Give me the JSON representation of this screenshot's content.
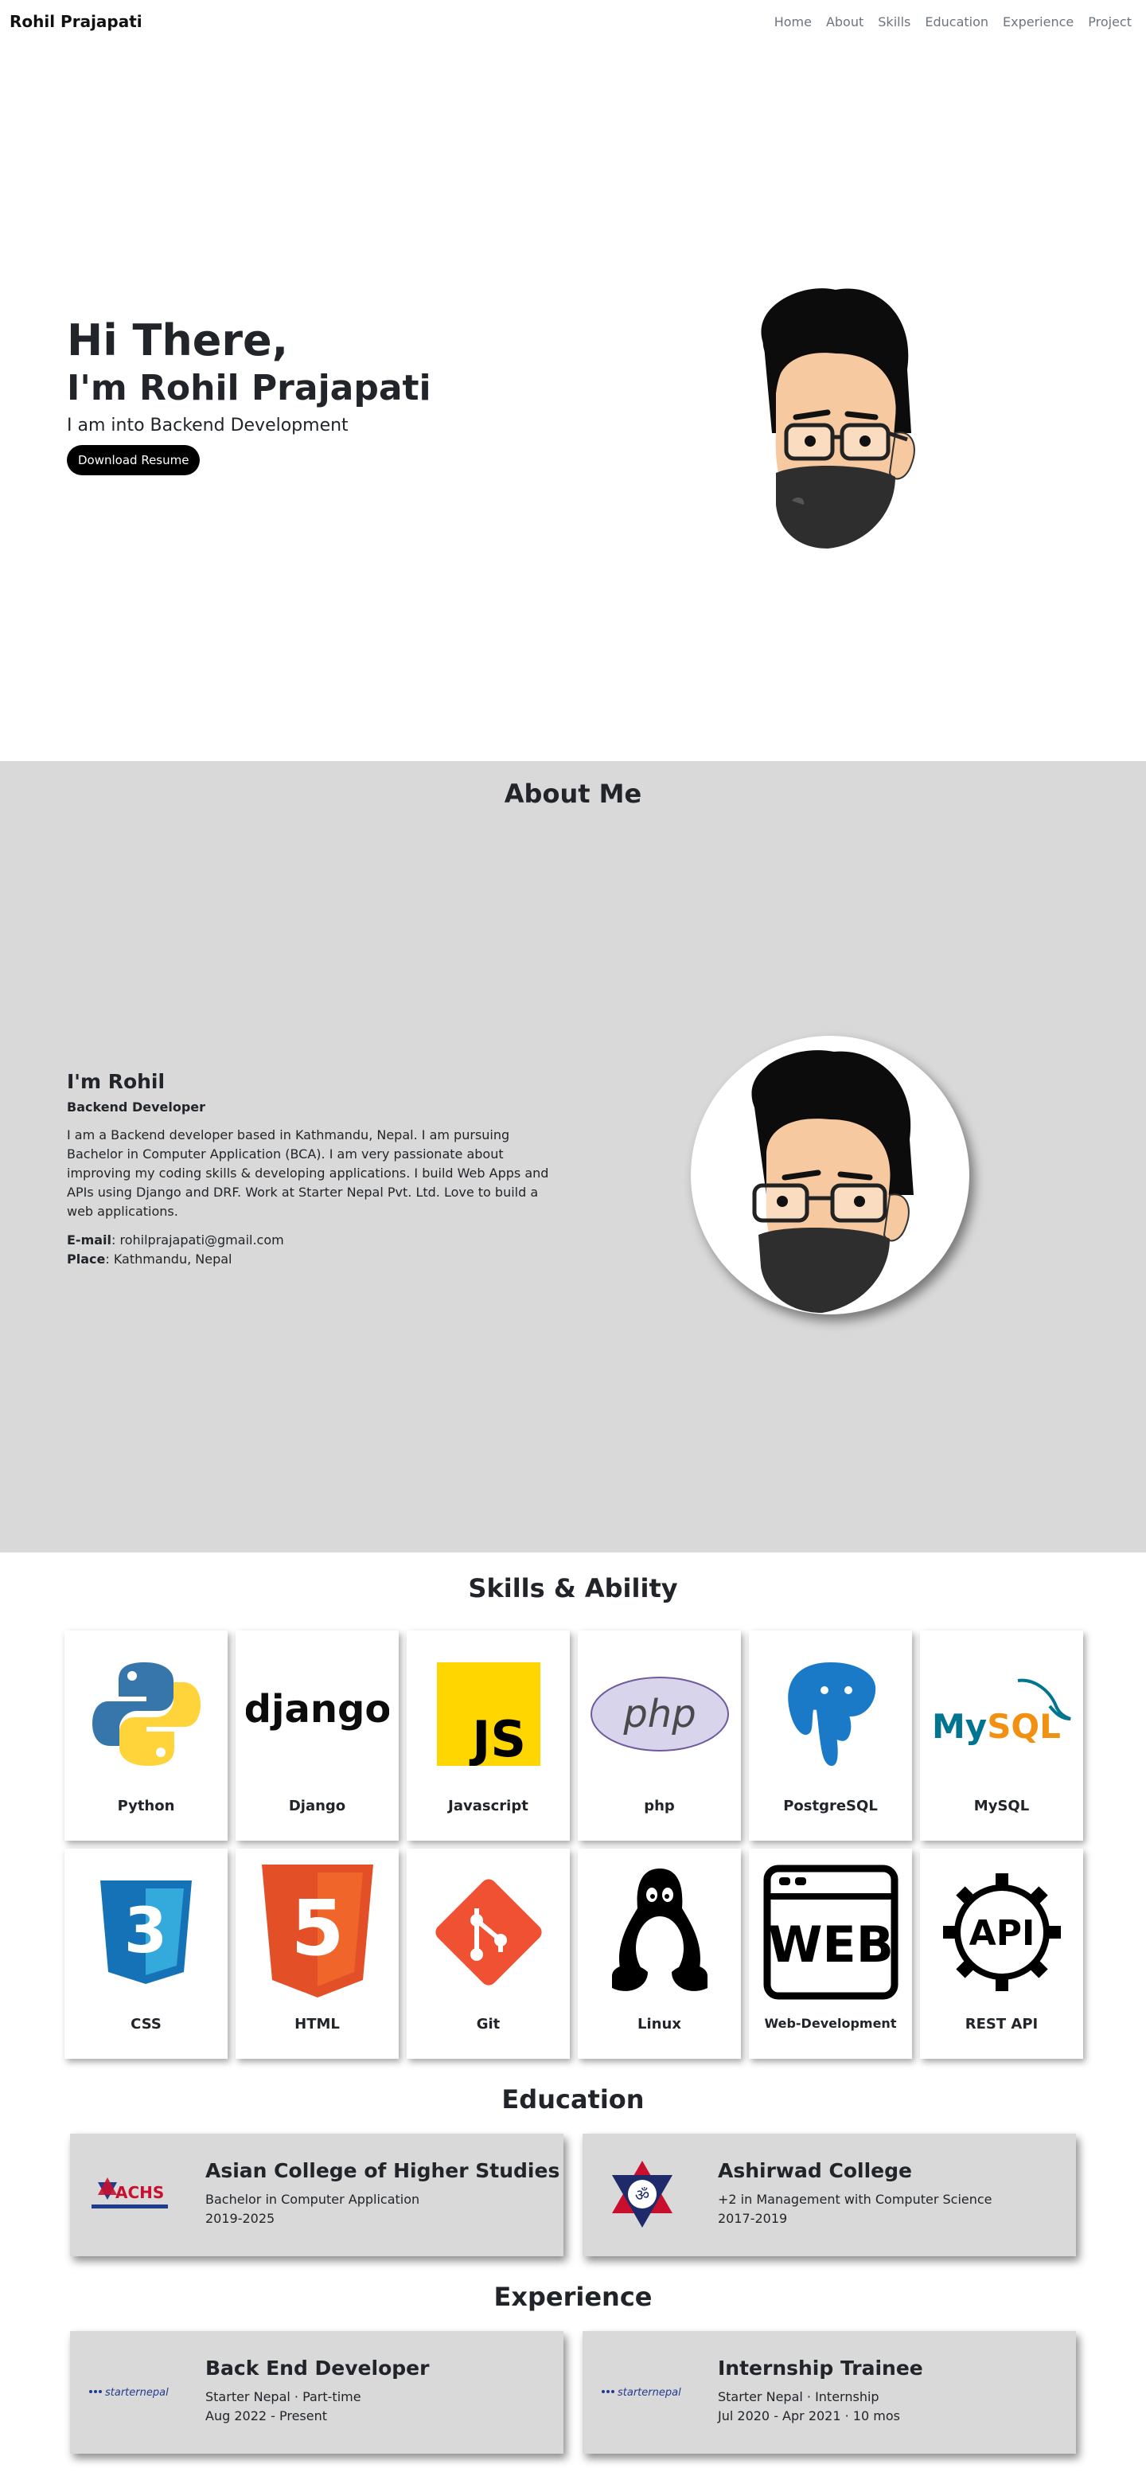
{
  "nav": {
    "brand": "Rohil Prajapati",
    "links": [
      "Home",
      "About",
      "Skills",
      "Education",
      "Experience",
      "Project"
    ]
  },
  "hero": {
    "greeting": "Hi There,",
    "name": "I'm Rohil Prajapati",
    "tagline": "I am into Backend Development",
    "button": "Download Resume"
  },
  "about": {
    "title": "About Me",
    "heading": "I'm Rohil",
    "role": "Backend Developer",
    "bio": "I am a Backend developer based in Kathmandu, Nepal. I am pursuing Bachelor in Computer Application (BCA). I am very passionate about improving my coding skills & developing applications. I build Web Apps and APIs using Django and DRF. Work at Starter Nepal Pvt. Ltd. Love to build a web applications.",
    "email_label": "E-mail",
    "email": "rohilprajapati@gmail.com",
    "place_label": "Place",
    "place": "Kathmandu, Nepal"
  },
  "skills": {
    "title": "Skills & Ability",
    "items": [
      {
        "label": "Python",
        "icon": "python-icon"
      },
      {
        "label": "Django",
        "icon": "django-icon"
      },
      {
        "label": "Javascript",
        "icon": "javascript-icon"
      },
      {
        "label": "php",
        "icon": "php-icon"
      },
      {
        "label": "PostgreSQL",
        "icon": "postgresql-icon"
      },
      {
        "label": "MySQL",
        "icon": "mysql-icon"
      },
      {
        "label": "CSS",
        "icon": "css-icon"
      },
      {
        "label": "HTML",
        "icon": "html-icon"
      },
      {
        "label": "Git",
        "icon": "git-icon"
      },
      {
        "label": "Linux",
        "icon": "linux-icon"
      },
      {
        "label": "Web-Development",
        "icon": "web-icon"
      },
      {
        "label": "REST API",
        "icon": "api-icon"
      }
    ],
    "icon_text": {
      "django": "django",
      "js": "JS",
      "php": "php",
      "mysql_a": "My",
      "mysql_b": "SQL",
      "css": "3",
      "html": "5",
      "web": "WEB",
      "api": "API"
    }
  },
  "education": {
    "title": "Education",
    "items": [
      {
        "school": "Asian College of Higher Studies",
        "degree": "Bachelor in Computer Application",
        "years": "2019-2025",
        "logo_text": "ACHS"
      },
      {
        "school": "Ashirwad College",
        "degree": "+2 in Management with Computer Science",
        "years": "2017-2019",
        "logo_text": "ॐ"
      }
    ]
  },
  "experience": {
    "title": "Experience",
    "items": [
      {
        "role": "Back End Developer",
        "company": "Starter Nepal · Part-time",
        "period": "Aug 2022 - Present",
        "logo_text": "starternepal"
      },
      {
        "role": "Internship Trainee",
        "company": "Starter Nepal · Internship",
        "period": "Jul 2020 - Apr 2021 · 10 mos",
        "logo_text": "starternepal"
      }
    ]
  },
  "colors": {
    "section_grey": "#d9d9d9",
    "python_blue": "#3776ab",
    "python_yellow": "#ffd43b",
    "js_yellow": "#f7df1e",
    "html_orange": "#e34f26",
    "css_blue": "#1572b6",
    "git_orange": "#f05133",
    "postgres_blue": "#336791",
    "mysql_blue": "#00758f",
    "mysql_orange": "#f29111"
  }
}
